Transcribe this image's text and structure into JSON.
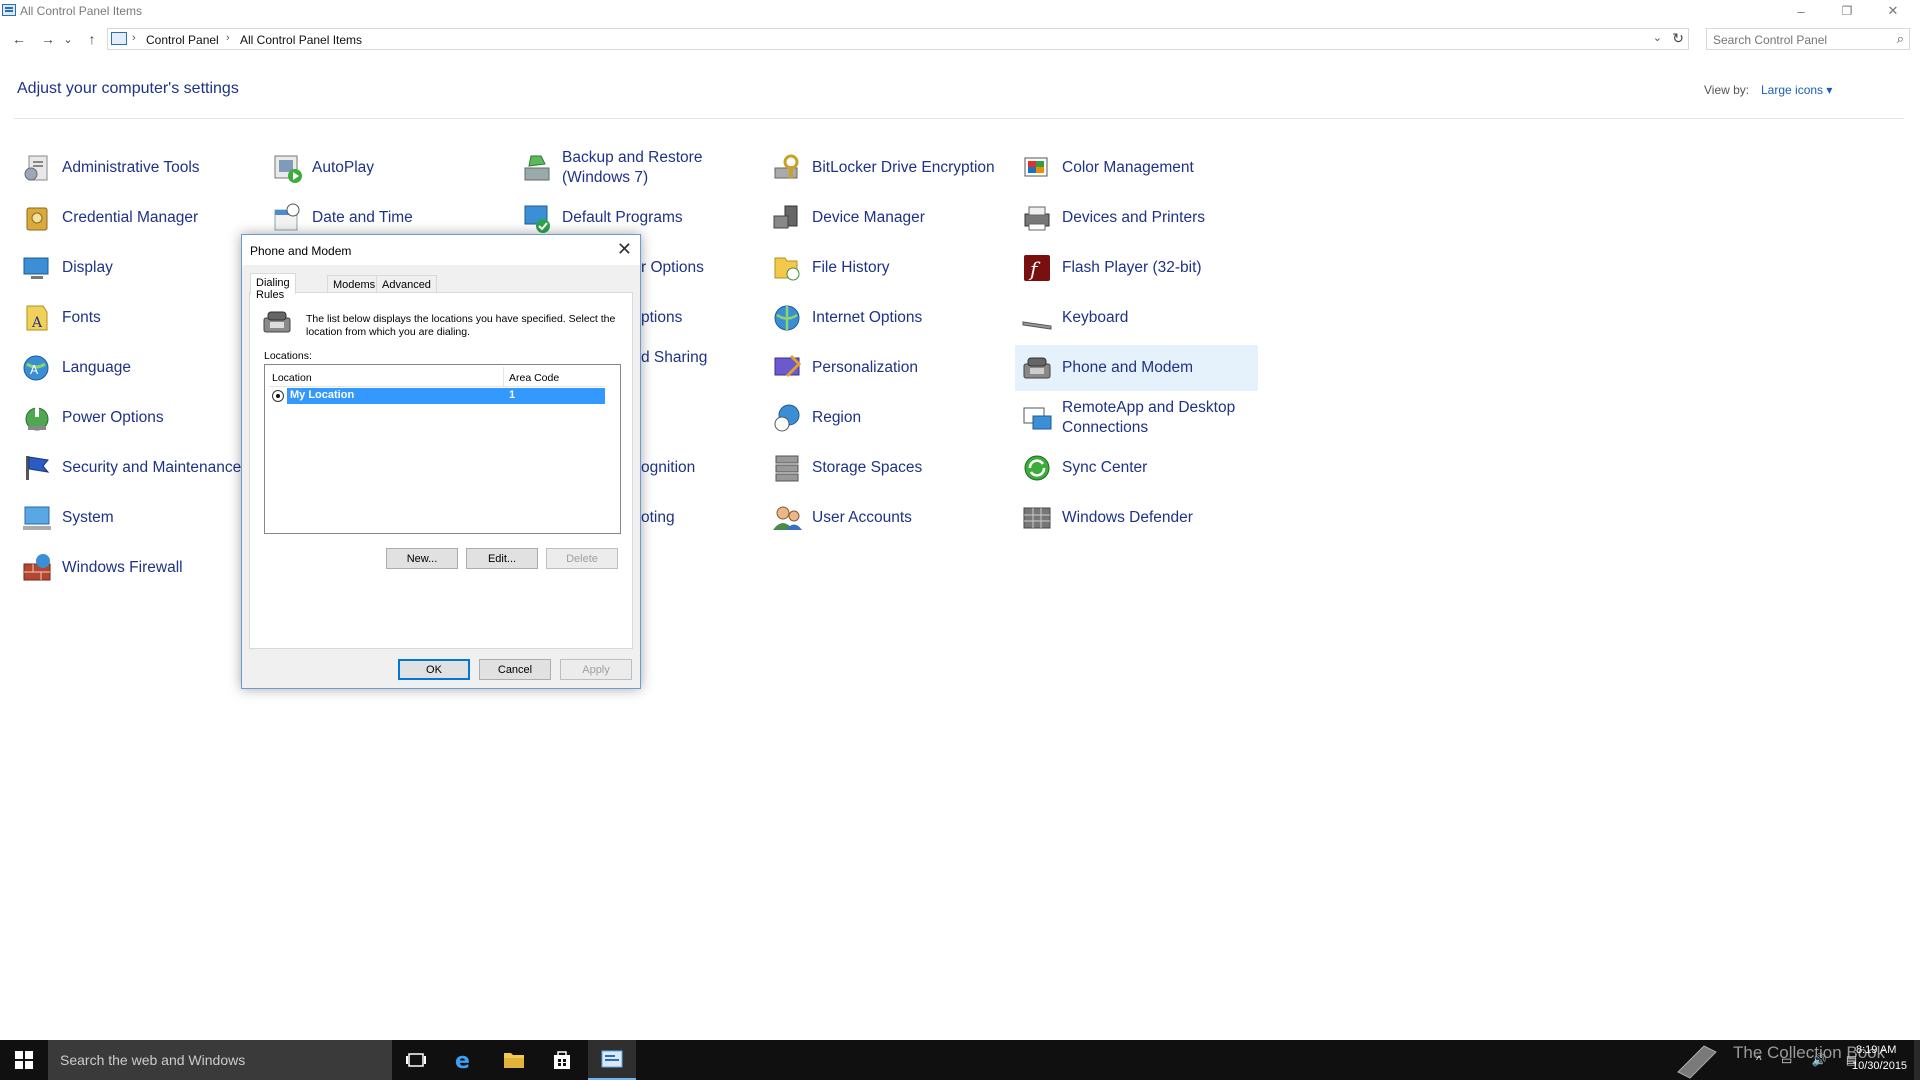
{
  "window": {
    "title": "All Control Panel Items",
    "minimize": "–",
    "restore": "❐",
    "close": "✕"
  },
  "nav": {
    "back": "←",
    "forward": "→",
    "recent": "⌄",
    "up": "↑"
  },
  "address": {
    "crumbs": [
      "Control Panel",
      "All Control Panel Items"
    ],
    "separator": "›"
  },
  "search": {
    "placeholder": "Search Control Panel"
  },
  "header": {
    "title": "Adjust your computer's settings",
    "view_by_label": "View by:",
    "view_by_value": "Large icons ▾"
  },
  "items": [
    {
      "label": "Administrative Tools",
      "icon": "admin-tools-icon"
    },
    {
      "label": "AutoPlay",
      "icon": "autoplay-icon"
    },
    {
      "label": "Backup and Restore (Windows 7)",
      "label_line1": "Backup and Restore",
      "label_line2": "(Windows 7)",
      "icon": "backup-icon"
    },
    {
      "label": "BitLocker Drive Encryption",
      "icon": "bitlocker-icon"
    },
    {
      "label": "Color Management",
      "icon": "color-management-icon"
    },
    {
      "label": "Credential Manager",
      "icon": "credential-manager-icon"
    },
    {
      "label": "Date and Time",
      "icon": "date-time-icon"
    },
    {
      "label": "Default Programs",
      "icon": "default-programs-icon"
    },
    {
      "label": "Device Manager",
      "icon": "device-manager-icon"
    },
    {
      "label": "Devices and Printers",
      "icon": "devices-printers-icon"
    },
    {
      "label": "Display",
      "icon": "display-icon"
    },
    {
      "label": "r Options",
      "icon": "hidden-icon"
    },
    {
      "label": "File History",
      "icon": "file-history-icon"
    },
    {
      "label": "Flash Player (32-bit)",
      "icon": "flash-player-icon"
    },
    {
      "label": "Fonts",
      "icon": "fonts-icon"
    },
    {
      "label": "ptions",
      "icon": "hidden-icon"
    },
    {
      "label": "Internet Options",
      "icon": "internet-options-icon"
    },
    {
      "label": "Keyboard",
      "icon": "keyboard-icon"
    },
    {
      "label": "Language",
      "icon": "language-icon"
    },
    {
      "label": "d Sharing",
      "icon": "hidden-icon"
    },
    {
      "label": "Personalization",
      "icon": "personalization-icon"
    },
    {
      "label": "Phone and Modem",
      "icon": "phone-modem-icon"
    },
    {
      "label": "Power Options",
      "icon": "power-options-icon"
    },
    {
      "label": "Region",
      "icon": "region-icon"
    },
    {
      "label": "RemoteApp and Desktop Connections",
      "label_line1": "RemoteApp and Desktop",
      "label_line2": "Connections",
      "icon": "remoteapp-icon"
    },
    {
      "label": "Security and Maintenance",
      "icon": "security-maintenance-icon"
    },
    {
      "label": "ognition",
      "icon": "hidden-icon"
    },
    {
      "label": "Storage Spaces",
      "icon": "storage-spaces-icon"
    },
    {
      "label": "Sync Center",
      "icon": "sync-center-icon"
    },
    {
      "label": "System",
      "icon": "system-icon"
    },
    {
      "label": "oting",
      "icon": "hidden-icon"
    },
    {
      "label": "User Accounts",
      "icon": "user-accounts-icon"
    },
    {
      "label": "Windows Defender",
      "icon": "windows-defender-icon"
    },
    {
      "label": "Windows Firewall",
      "icon": "windows-firewall-icon"
    }
  ],
  "dialog": {
    "title": "Phone and Modem",
    "close": "✕",
    "tabs": [
      "Dialing Rules",
      "Modems",
      "Advanced"
    ],
    "description": "The list below displays the locations you have specified. Select the location from which you are dialing.",
    "locations_label": "Locations:",
    "columns": [
      "Location",
      "Area Code"
    ],
    "rows": [
      {
        "location": "My Location",
        "area_code": "1"
      }
    ],
    "buttons": {
      "new": "New...",
      "edit": "Edit...",
      "delete": "Delete",
      "ok": "OK",
      "cancel": "Cancel",
      "apply": "Apply"
    }
  },
  "taskbar": {
    "search_placeholder": "Search the web and Windows",
    "watermark": "The Collection Book",
    "time": "8:19 AM",
    "date": "10/30/2015"
  }
}
